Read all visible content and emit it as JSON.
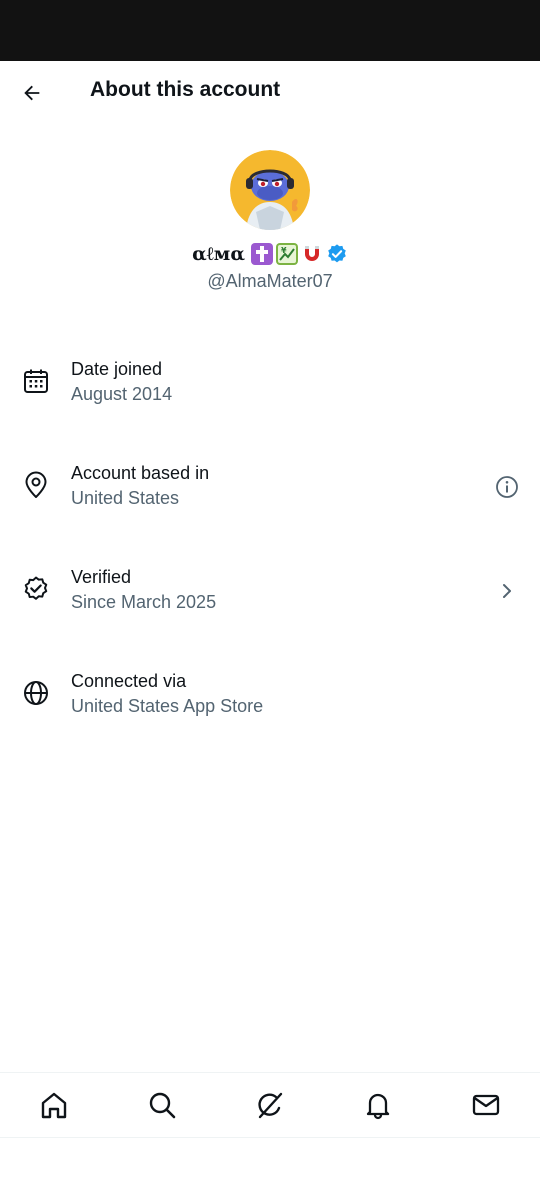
{
  "header": {
    "title": "About this account",
    "back_icon": "arrow-left-icon"
  },
  "profile": {
    "display_name": "αℓмα",
    "badges": [
      "latin-cross-emoji",
      "chart-yen-emoji",
      "magnet-emoji",
      "verified-badge-icon"
    ],
    "handle": "@AlmaMater07",
    "verified_color": "#1d9bf0"
  },
  "info": [
    {
      "icon": "calendar-icon",
      "title": "Date joined",
      "value": "August 2014",
      "action": null
    },
    {
      "icon": "location-pin-icon",
      "title": "Account based in",
      "value": "United States",
      "action": "info-icon"
    },
    {
      "icon": "verified-check-icon",
      "title": "Verified",
      "value": "Since March 2025",
      "action": "chevron-right-icon"
    },
    {
      "icon": "globe-icon",
      "title": "Connected via",
      "value": "United States App Store",
      "action": null
    }
  ],
  "bottom_nav": [
    "home-icon",
    "search-icon",
    "grok-icon",
    "notifications-bell-icon",
    "messages-mail-icon"
  ],
  "colors": {
    "primary_text": "#0f1419",
    "secondary_text": "#536471",
    "status_bar": "#121212",
    "divider": "#eff3f4"
  }
}
